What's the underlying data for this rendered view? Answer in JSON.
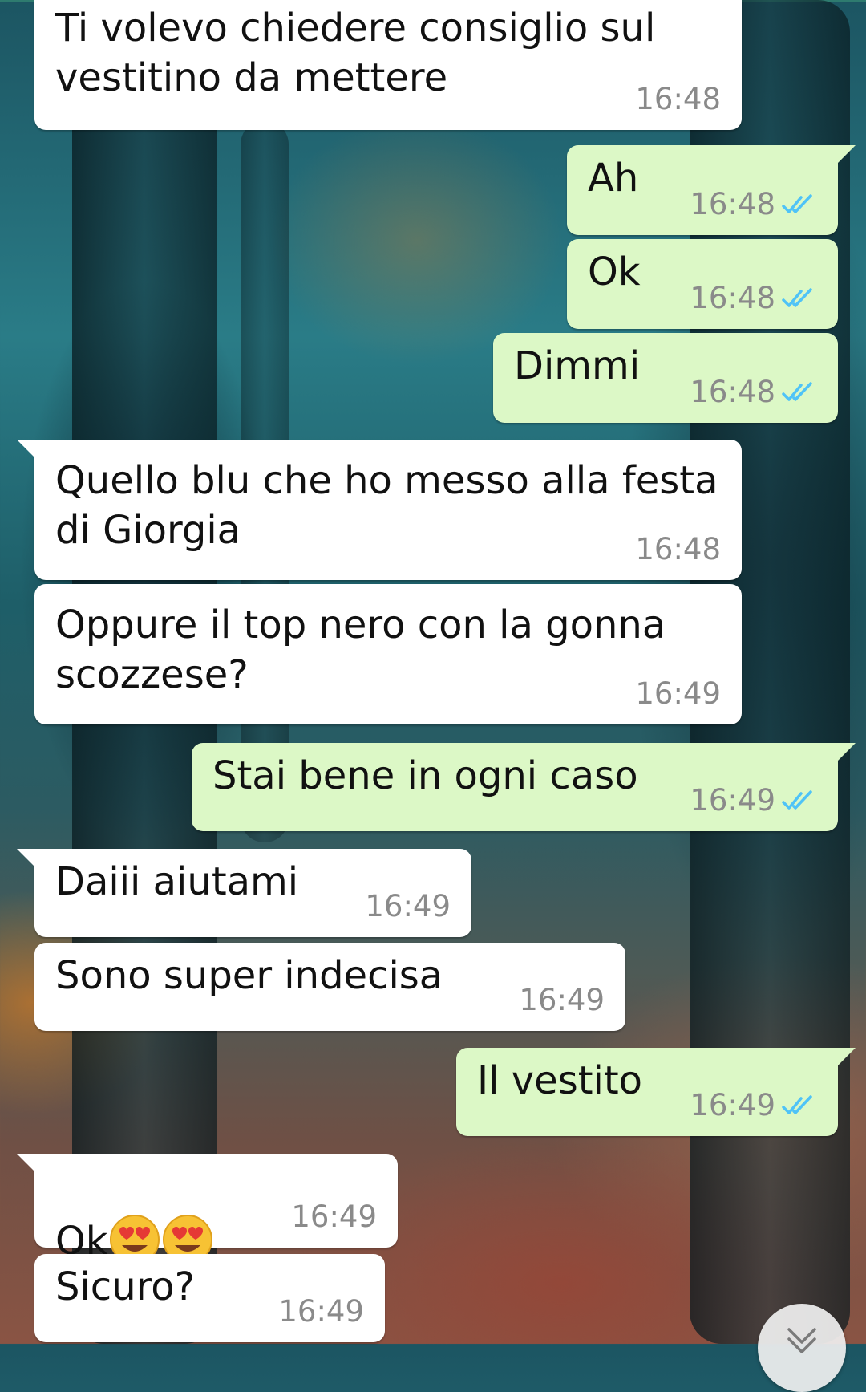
{
  "theme": {
    "incoming_bubble": "#ffffff",
    "outgoing_bubble": "#dcf8c6",
    "read_ticks": "#4fc3f7",
    "time_color": "#8a8a8a"
  },
  "messages": [
    {
      "direction": "in",
      "text": "Ti volevo chiedere consiglio sul\nvestitino da mettere",
      "time": "16:48"
    },
    {
      "direction": "out",
      "text": "Ah",
      "time": "16:48",
      "status": "read-double-tick-icon"
    },
    {
      "direction": "out",
      "text": "Ok",
      "time": "16:48",
      "status": "read-double-tick-icon"
    },
    {
      "direction": "out",
      "text": "Dimmi",
      "time": "16:48",
      "status": "read-double-tick-icon"
    },
    {
      "direction": "in",
      "text": "Quello blu che ho messo alla festa\ndi Giorgia",
      "time": "16:48"
    },
    {
      "direction": "in",
      "text": "Oppure il top nero con la gonna\nscozzese?",
      "time": "16:49"
    },
    {
      "direction": "out",
      "text": "Stai bene in ogni caso",
      "time": "16:49",
      "status": "read-double-tick-icon"
    },
    {
      "direction": "in",
      "text": "Daiii aiutami",
      "time": "16:49"
    },
    {
      "direction": "in",
      "text": "Sono super indecisa",
      "time": "16:49"
    },
    {
      "direction": "out",
      "text": "Il vestito",
      "time": "16:49",
      "status": "read-double-tick-icon"
    },
    {
      "direction": "in",
      "text": "Ok",
      "emojis": [
        "heart-eyes-emoji",
        "heart-eyes-emoji"
      ],
      "time": "16:49"
    },
    {
      "direction": "in",
      "text": "Sicuro?",
      "time": "16:49"
    }
  ],
  "scroll_button": {
    "icon": "chevron-down-icon"
  }
}
